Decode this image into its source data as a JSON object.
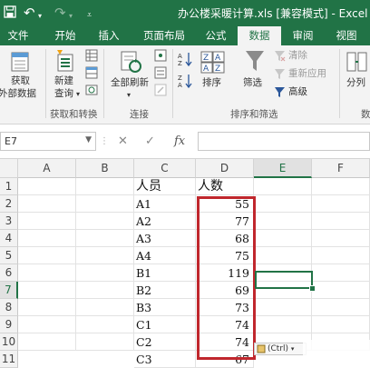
{
  "titlebar": {
    "title": "办公楼采暖计算.xls  [兼容模式] - Excel",
    "undo_icon": "undo-icon",
    "redo_icon": "redo-icon",
    "customize_icon": "quick-access-dropdown-icon"
  },
  "tabs": [
    {
      "label": "文件"
    },
    {
      "label": "开始"
    },
    {
      "label": "插入"
    },
    {
      "label": "页面布局"
    },
    {
      "label": "公式"
    },
    {
      "label": "数据",
      "active": true
    },
    {
      "label": "审阅"
    },
    {
      "label": "视图"
    }
  ],
  "ribbon": {
    "get_external": {
      "line1": "获取",
      "line2": "外部数据"
    },
    "new_query": {
      "line1": "新建",
      "line2": "查询"
    },
    "group_get_transform": "获取和转换",
    "refresh_all": "全部刷新",
    "group_connections": "连接",
    "sort": "排序",
    "filter": "筛选",
    "clear": "清除",
    "reapply": "重新应用",
    "advanced": "高级",
    "group_sort_filter": "排序和筛选",
    "split": "分列",
    "group_data_tools_partial": "数"
  },
  "formula_bar": {
    "name_box": "E7",
    "cancel_symbol": "✕",
    "enter_symbol": "✓",
    "fx_symbol": "fx",
    "content": ""
  },
  "sheet": {
    "columns": [
      "A",
      "B",
      "C",
      "D",
      "E",
      "F"
    ],
    "selected_column": "E",
    "rows": [
      {
        "num": "1",
        "c": "人员",
        "d": "人数"
      },
      {
        "num": "2",
        "c": "A1",
        "d": "55"
      },
      {
        "num": "3",
        "c": "A2",
        "d": "77"
      },
      {
        "num": "4",
        "c": "A3",
        "d": "68"
      },
      {
        "num": "5",
        "c": "A4",
        "d": "75"
      },
      {
        "num": "6",
        "c": "B1",
        "d": "119"
      },
      {
        "num": "7",
        "c": "B2",
        "d": "69"
      },
      {
        "num": "8",
        "c": "B3",
        "d": "73"
      },
      {
        "num": "9",
        "c": "C1",
        "d": "74"
      },
      {
        "num": "10",
        "c": "C2",
        "d": "74"
      },
      {
        "num": "11",
        "c": "C3",
        "d": "67"
      }
    ],
    "selected_row": "7",
    "active_cell": "E7",
    "paste_options_label": "(Ctrl)",
    "highlight_color": "#c0272d"
  },
  "colors": {
    "excel_green": "#217346",
    "ribbon_bg": "#f3f3f3"
  }
}
